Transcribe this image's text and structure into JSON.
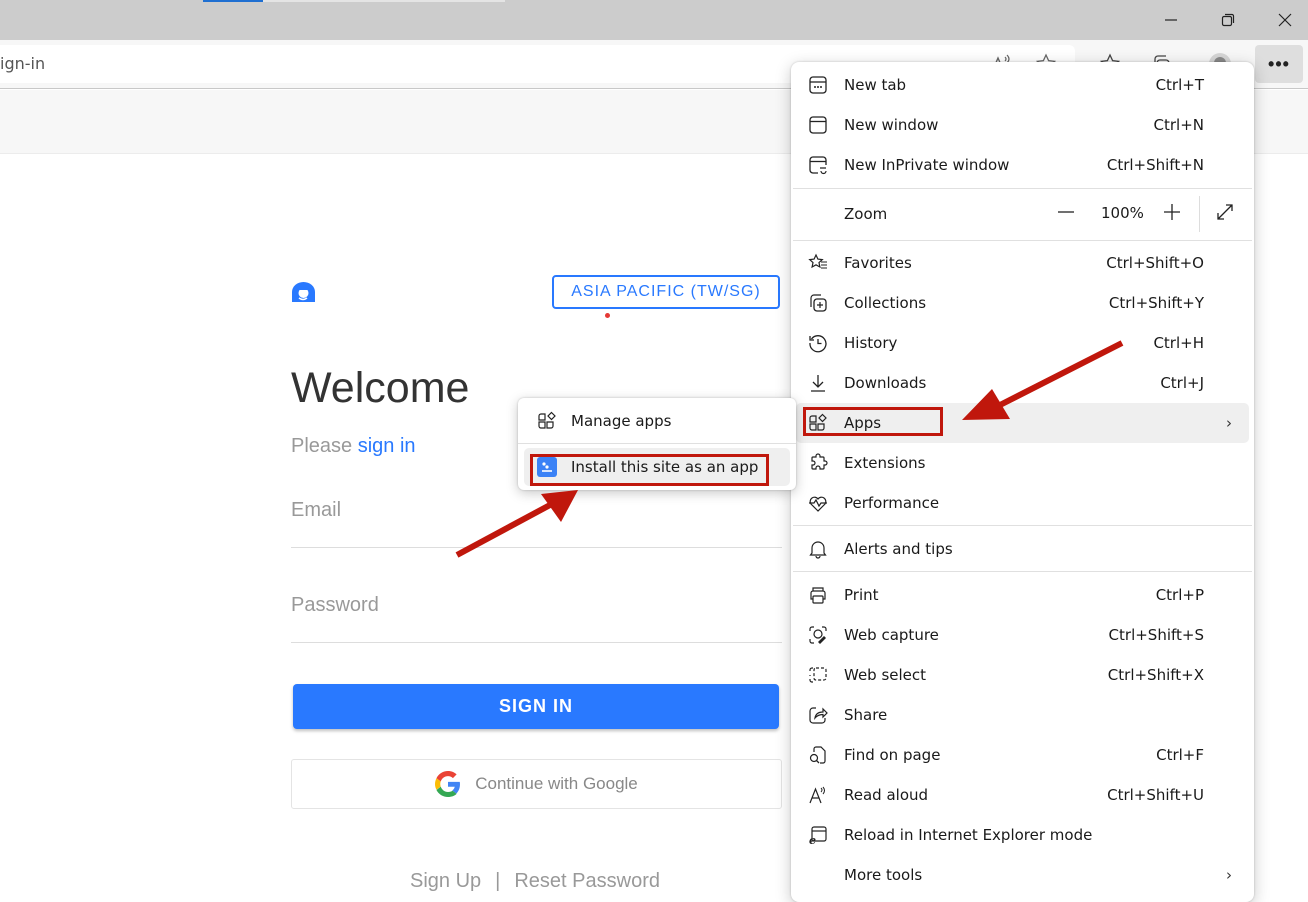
{
  "browser": {
    "address_bar_text": "ign-in",
    "more_button_label": "•••",
    "window_controls": [
      "minimize",
      "restore",
      "close"
    ],
    "toolbar_icons": [
      "read-aloud-icon",
      "favorite-star-icon",
      "favorites-icon",
      "collections-icon",
      "profile-avatar"
    ]
  },
  "page": {
    "region_button": "ASIA PACIFIC (TW/SG)",
    "welcome_title": "Welcome",
    "please_text": "Please ",
    "sign_in_link": "sign in",
    "email_placeholder": "Email",
    "password_placeholder": "Password",
    "sign_in_button": "SIGN IN",
    "google_button": "Continue with Google",
    "sign_up_link": "Sign Up",
    "footer_separator": "|",
    "reset_password_link": "Reset Password",
    "accent_color": "#2979ff"
  },
  "menu": {
    "items": [
      {
        "label": "New tab",
        "shortcut": "Ctrl+T",
        "icon": "new-tab-icon"
      },
      {
        "label": "New window",
        "shortcut": "Ctrl+N",
        "icon": "new-window-icon"
      },
      {
        "label": "New InPrivate window",
        "shortcut": "Ctrl+Shift+N",
        "icon": "inprivate-icon"
      },
      {
        "label": "Zoom",
        "icon": "none"
      },
      {
        "label": "Favorites",
        "shortcut": "Ctrl+Shift+O",
        "icon": "favorites-icon"
      },
      {
        "label": "Collections",
        "shortcut": "Ctrl+Shift+Y",
        "icon": "collections-icon"
      },
      {
        "label": "History",
        "shortcut": "Ctrl+H",
        "icon": "history-icon"
      },
      {
        "label": "Downloads",
        "shortcut": "Ctrl+J",
        "icon": "downloads-icon"
      },
      {
        "label": "Apps",
        "shortcut": "",
        "icon": "apps-icon"
      },
      {
        "label": "Extensions",
        "shortcut": "",
        "icon": "extensions-icon"
      },
      {
        "label": "Performance",
        "shortcut": "",
        "icon": "performance-icon"
      },
      {
        "label": "Alerts and tips",
        "shortcut": "",
        "icon": "bell-icon"
      },
      {
        "label": "Print",
        "shortcut": "Ctrl+P",
        "icon": "print-icon"
      },
      {
        "label": "Web capture",
        "shortcut": "Ctrl+Shift+S",
        "icon": "web-capture-icon"
      },
      {
        "label": "Web select",
        "shortcut": "Ctrl+Shift+X",
        "icon": "web-select-icon"
      },
      {
        "label": "Share",
        "shortcut": "",
        "icon": "share-icon"
      },
      {
        "label": "Find on page",
        "shortcut": "Ctrl+F",
        "icon": "find-icon"
      },
      {
        "label": "Read aloud",
        "shortcut": "Ctrl+Shift+U",
        "icon": "read-aloud-icon"
      },
      {
        "label": "Reload in Internet Explorer mode",
        "shortcut": "",
        "icon": "ie-mode-icon"
      },
      {
        "label": "More tools",
        "shortcut": "",
        "icon": "none"
      }
    ],
    "zoom": {
      "minus": "—",
      "value": "100%",
      "plus": "+"
    },
    "chevron": "›"
  },
  "submenu": {
    "items": [
      {
        "label": "Manage apps",
        "icon": "manage-apps-icon"
      },
      {
        "label": "Install this site as an app",
        "icon": "site-app-icon"
      }
    ]
  },
  "annotations": {
    "highlight_color": "#c0170c"
  }
}
